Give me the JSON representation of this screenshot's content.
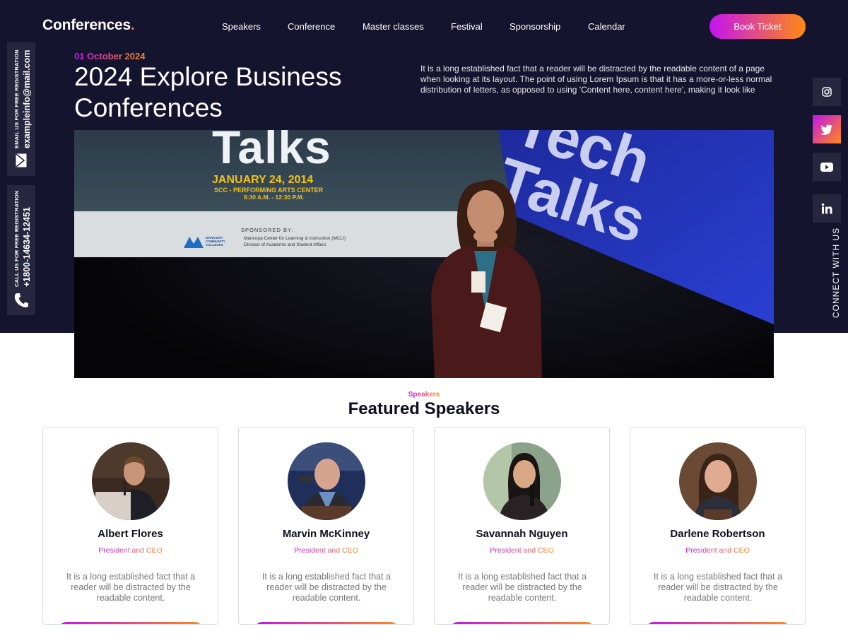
{
  "header": {
    "logo_text": "Conferences",
    "logo_dot": ".",
    "nav": [
      "Speakers",
      "Conference",
      "Master classes",
      "Festival",
      "Sponsorship",
      "Calendar"
    ],
    "book_label": "Book Ticket"
  },
  "contact": {
    "email_caption": "EMAIL US FOR FREE REGISTRATION",
    "email": "exampleinfo@mail.com",
    "phone_caption": "CALL US FOR FREE REGISTRATION",
    "phone": "+1800-14634-12451"
  },
  "hero": {
    "date": "01 October 2024",
    "title": "2024 Explore Business Conferences",
    "description": "It is a long established fact that a reader will be distracted by the readable content of a page when looking at its layout. The point of using Lorem Ipsum is that it has a more-or-less normal distribution of letters, as opposed to using 'Content here, content here', making it look like",
    "image": {
      "screen_brand": "Talks",
      "screen_date": "JANUARY 24, 2014",
      "screen_venue": "SCC - PERFORMING ARTS CENTER",
      "screen_time": "8:30 A.M. - 12:30 P.M.",
      "sponsored_label": "SPONSORED BY:",
      "sponsor_line1": "Maricopa Center for Learning & Instruction (MCLI)",
      "sponsor_line2": "Division of Academic and Student Affairs",
      "sponsor_logo_text": "MARICOPA COMMUNITY COLLEGES",
      "big_sign": "Tech Talks"
    }
  },
  "social": {
    "icons": [
      "instagram-icon",
      "twitter-icon",
      "youtube-icon",
      "linkedin-icon"
    ],
    "connect_label": "CONNECT WITH US"
  },
  "speakers": {
    "label": "Speakers",
    "title": "Featured Speakers",
    "items": [
      {
        "name": "Albert Flores",
        "role": "President and CEO",
        "bio": "It is a long established fact that a reader will be distracted by the readable content."
      },
      {
        "name": "Marvin McKinney",
        "role": "President and CEO",
        "bio": "It is a long established fact that a reader will be distracted by the readable content."
      },
      {
        "name": "Savannah Nguyen",
        "role": "President and CEO",
        "bio": "It is a long established fact that a reader will be distracted by the readable content."
      },
      {
        "name": "Darlene Robertson",
        "role": "President and CEO",
        "bio": "It is a long established fact that a reader will be distracted by the readable content."
      }
    ]
  },
  "colors": {
    "dark_bg": "#14142e",
    "panel": "#26263e",
    "gradient_start": "#c413f0",
    "gradient_end": "#ff8a12"
  }
}
